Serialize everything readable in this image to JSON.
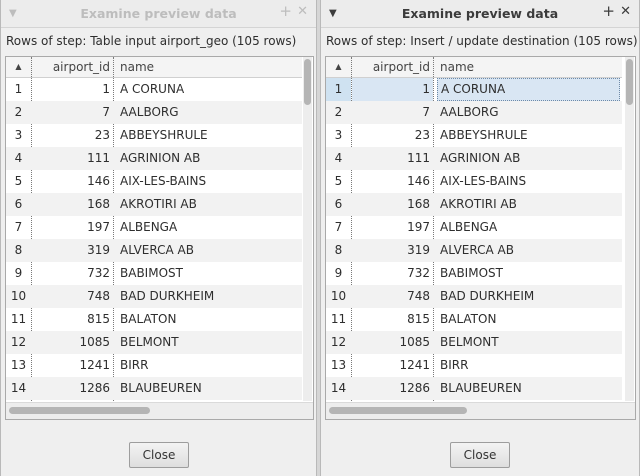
{
  "left": {
    "title": "Examine preview data",
    "rows_label": "Rows of step: Table input airport_geo (105 rows)",
    "columns": {
      "index": "▲",
      "id": "airport_id",
      "name": "name"
    },
    "close_label": "Close",
    "active": false
  },
  "right": {
    "title": "Examine preview data",
    "rows_label": "Rows of step: Insert / update destination (105 rows)",
    "columns": {
      "index": "▲",
      "id": "airport_id",
      "name": "name"
    },
    "close_label": "Close",
    "active": true,
    "selected_row": 1
  },
  "titlebar_icons": {
    "menu": "chevron-down-icon",
    "pin": "pin-icon",
    "close": "close-icon"
  },
  "rows": [
    {
      "idx": "1",
      "id": "1",
      "name": "A CORUNA"
    },
    {
      "idx": "2",
      "id": "7",
      "name": "AALBORG"
    },
    {
      "idx": "3",
      "id": "23",
      "name": "ABBEYSHRULE"
    },
    {
      "idx": "4",
      "id": "111",
      "name": "AGRINION AB"
    },
    {
      "idx": "5",
      "id": "146",
      "name": "AIX-LES-BAINS"
    },
    {
      "idx": "6",
      "id": "168",
      "name": "AKROTIRI AB"
    },
    {
      "idx": "7",
      "id": "197",
      "name": "ALBENGA"
    },
    {
      "idx": "8",
      "id": "319",
      "name": "ALVERCA AB"
    },
    {
      "idx": "9",
      "id": "732",
      "name": "BABIMOST"
    },
    {
      "idx": "10",
      "id": "748",
      "name": "BAD DURKHEIM"
    },
    {
      "idx": "11",
      "id": "815",
      "name": "BALATON"
    },
    {
      "idx": "12",
      "id": "1085",
      "name": "BELMONT"
    },
    {
      "idx": "13",
      "id": "1241",
      "name": "BIRR"
    },
    {
      "idx": "14",
      "id": "1286",
      "name": "BLAUBEUREN"
    }
  ]
}
